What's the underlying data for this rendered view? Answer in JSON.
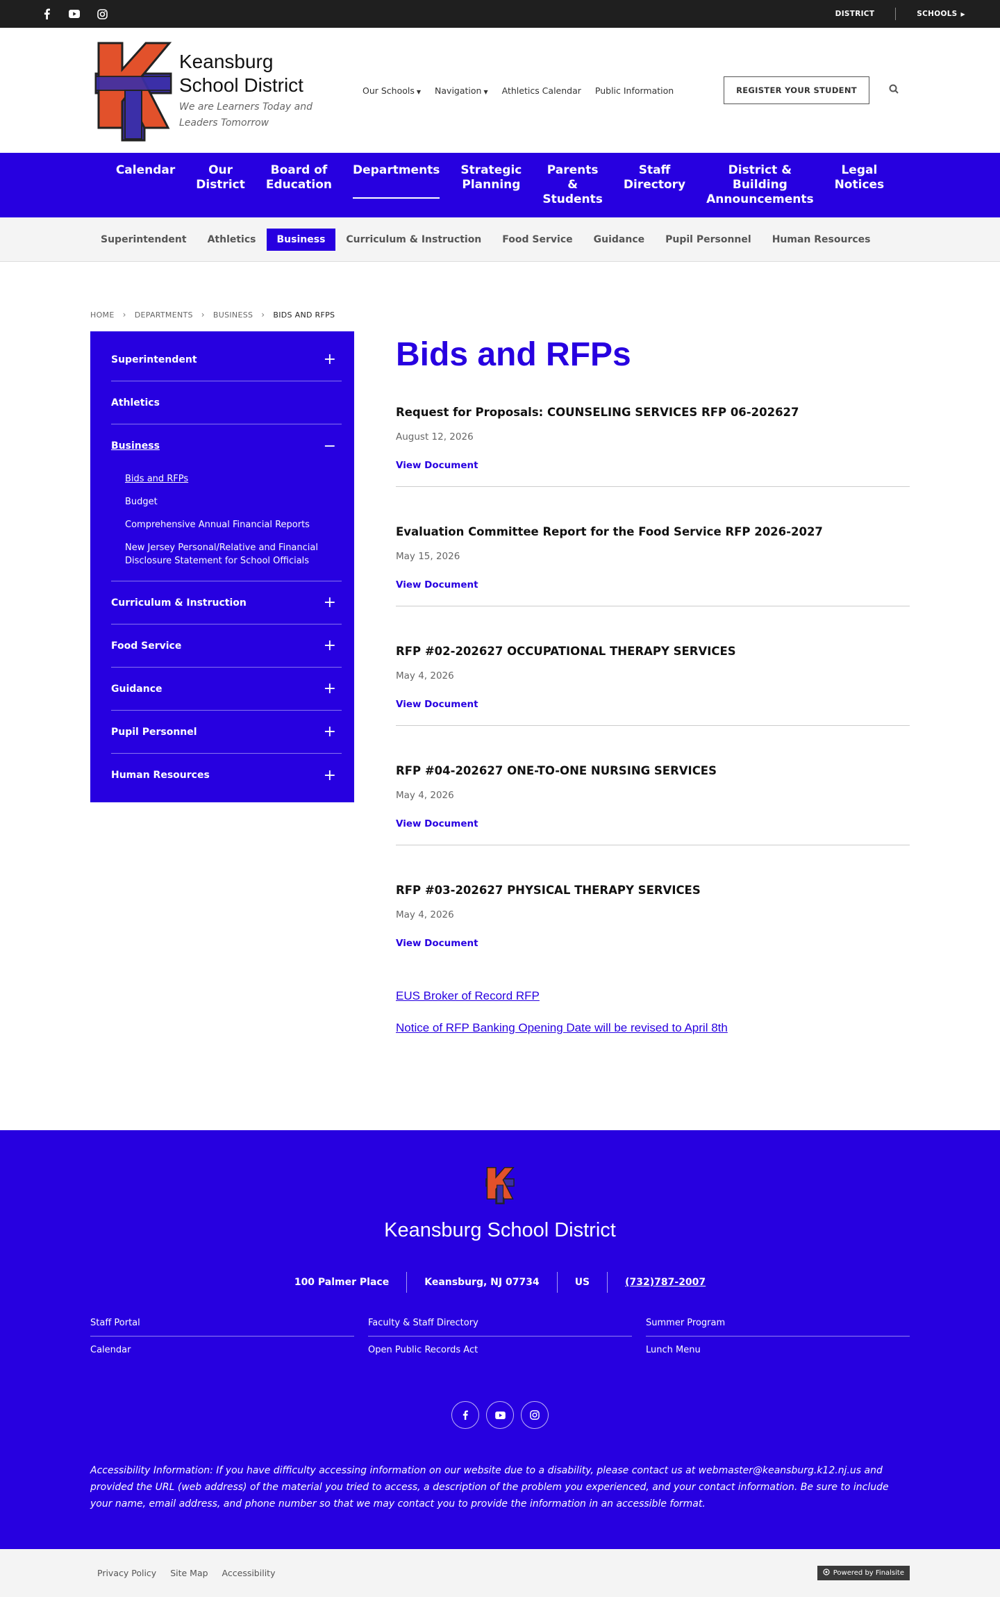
{
  "topbar": {
    "social_icons": [
      "facebook-icon",
      "youtube-icon",
      "instagram-icon"
    ],
    "district_label": "DISTRICT",
    "schools_label": "SCHOOLS"
  },
  "header": {
    "name_line1": "Keansburg",
    "name_line2": "School District",
    "tagline_line1": "We are Learners Today and",
    "tagline_line2": "Leaders Tomorrow",
    "nav": [
      {
        "label": "Our Schools",
        "dropdown": true
      },
      {
        "label": "Navigation",
        "dropdown": true
      },
      {
        "label": "Athletics Calendar",
        "dropdown": false
      },
      {
        "label": "Public Information",
        "dropdown": false
      }
    ],
    "register_label": "REGISTER YOUR STUDENT"
  },
  "main_nav": [
    {
      "label": "Calendar"
    },
    {
      "label": "Our\nDistrict"
    },
    {
      "label": "Board of\nEducation"
    },
    {
      "label": "Departments",
      "active": true
    },
    {
      "label": "Strategic\nPlanning"
    },
    {
      "label": "Parents\n&\nStudents"
    },
    {
      "label": "Staff\nDirectory"
    },
    {
      "label": "District &\nBuilding\nAnnouncements"
    },
    {
      "label": "Legal\nNotices"
    }
  ],
  "sub_nav": [
    {
      "label": "Superintendent"
    },
    {
      "label": "Athletics"
    },
    {
      "label": "Business",
      "active": true
    },
    {
      "label": "Curriculum & Instruction"
    },
    {
      "label": "Food Service"
    },
    {
      "label": "Guidance"
    },
    {
      "label": "Pupil Personnel"
    },
    {
      "label": "Human Resources"
    }
  ],
  "breadcrumb": [
    "HOME",
    "DEPARTMENTS",
    "BUSINESS",
    "BIDS AND RFPS"
  ],
  "sidebar": {
    "items": [
      {
        "label": "Superintendent"
      },
      {
        "label": "Athletics"
      },
      {
        "label": "Business"
      },
      {
        "label": "Curriculum & Instruction"
      },
      {
        "label": "Food Service"
      },
      {
        "label": "Guidance"
      },
      {
        "label": "Pupil Personnel"
      },
      {
        "label": "Human Resources"
      }
    ],
    "business_sub": [
      "Bids and RFPs",
      "Budget",
      "Comprehensive Annual Financial Reports",
      "New Jersey Personal/Relative and Financial Disclosure Statement for School Officials"
    ]
  },
  "page": {
    "title": "Bids and RFPs",
    "view_label": "View Document",
    "documents": [
      {
        "title": "Request for Proposals: COUNSELING SERVICES RFP 06-202627",
        "date": "August 12, 2026"
      },
      {
        "title": "Evaluation Committee Report for the Food Service RFP 2026-2027",
        "date": "May 15, 2026"
      },
      {
        "title": "RFP #02-202627 OCCUPATIONAL THERAPY SERVICES",
        "date": "May 4, 2026"
      },
      {
        "title": "RFP #04-202627 ONE-TO-ONE NURSING SERVICES",
        "date": "May 4, 2026"
      },
      {
        "title": "RFP #03-202627 PHYSICAL THERAPY SERVICES",
        "date": "May 4, 2026"
      }
    ],
    "extra_links": [
      "EUS Broker of Record RFP",
      "Notice of RFP Banking Opening Date will be revised to April 8th"
    ]
  },
  "footer": {
    "name": "Keansburg School District",
    "street": "100 Palmer Place",
    "city": "Keansburg, NJ  07734",
    "country": "US",
    "phone": "(732)787-2007",
    "links": [
      "Staff Portal",
      "Faculty & Staff Directory",
      "Summer Program",
      "Calendar",
      "Open Public Records Act",
      "Lunch Menu"
    ],
    "accessibility": "Accessibility Information: If you have difficulty accessing information on our website due to a disability, please contact us at webmaster@keansburg.k12.nj.us and provided the URL (web address) of the material you tried to access, a description of the problem you experienced, and your contact information. Be sure to include your name, email address, and phone number so that we may contact you to provide the information in an accessible format."
  },
  "bottom": {
    "links": [
      "Privacy Policy",
      "Site Map",
      "Accessibility"
    ],
    "powered": "Powered by Finalsite"
  },
  "colors": {
    "brand_blue": "#2700e0",
    "logo_orange": "#e2512b",
    "logo_blue": "#3b2fa8",
    "topbar": "#1f1f1f"
  }
}
